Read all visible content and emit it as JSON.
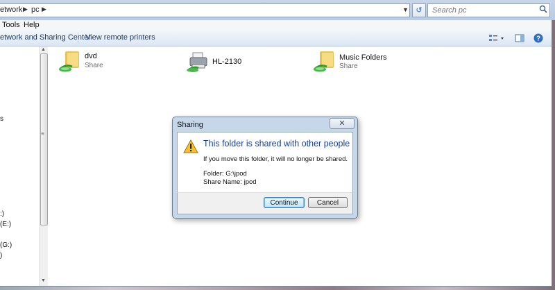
{
  "address_bar": {
    "crumbs": [
      "etwork",
      "pc"
    ],
    "search_placeholder": "Search pc"
  },
  "menu": [
    "Tools",
    "Help"
  ],
  "command_bar": {
    "items": [
      "etwork and Sharing Center",
      "View remote printers"
    ]
  },
  "nav_pane": {
    "fragments": [
      "s",
      ":)",
      "(E:)",
      "(G:)",
      ")"
    ]
  },
  "content_items": [
    {
      "name": "dvd",
      "sub": "Share",
      "icon": "shared-folder-icon"
    },
    {
      "name": "HL-2130",
      "sub": "",
      "icon": "printer-icon"
    },
    {
      "name": "Music Folders",
      "sub": "Share",
      "icon": "shared-folder-icon"
    }
  ],
  "dialog": {
    "title": "Sharing",
    "close_label": "✕",
    "heading": "This folder is shared with other people",
    "message": "If you move this folder, it will no longer be shared.",
    "folder_line": "Folder:  G:\\jpod",
    "share_line": "Share Name:  jpod",
    "continue_label": "Continue",
    "cancel_label": "Cancel"
  },
  "colors": {
    "heading_blue": "#1c3f95",
    "command_text": "#1e395b",
    "warning_yellow": "#f6c12e"
  }
}
